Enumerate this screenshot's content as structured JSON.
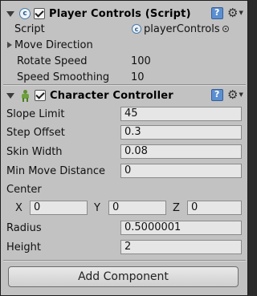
{
  "player_controls": {
    "title": "Player Controls (Script)",
    "script_label": "Script",
    "script_value": "playerControls",
    "move_direction_label": "Move Direction",
    "rotate_speed_label": "Rotate Speed",
    "rotate_speed_value": "100",
    "speed_smoothing_label": "Speed Smoothing",
    "speed_smoothing_value": "10"
  },
  "character_controller": {
    "title": "Character Controller",
    "slope_limit_label": "Slope Limit",
    "slope_limit_value": "45",
    "step_offset_label": "Step Offset",
    "step_offset_value": "0.3",
    "skin_width_label": "Skin Width",
    "skin_width_value": "0.08",
    "min_move_distance_label": "Min Move Distance",
    "min_move_distance_value": "0",
    "center_label": "Center",
    "center_x_label": "X",
    "center_x_value": "0",
    "center_y_label": "Y",
    "center_y_value": "0",
    "center_z_label": "Z",
    "center_z_value": "0",
    "radius_label": "Radius",
    "radius_value": "0.5000001",
    "height_label": "Height",
    "height_value": "2"
  },
  "add_component_label": "Add Component",
  "icons": {
    "foldout": "triangle-down-icon",
    "script": "csharp-script-icon",
    "character_controller": "character-controller-icon",
    "help": "help-book-icon",
    "settings": "gear-icon"
  }
}
